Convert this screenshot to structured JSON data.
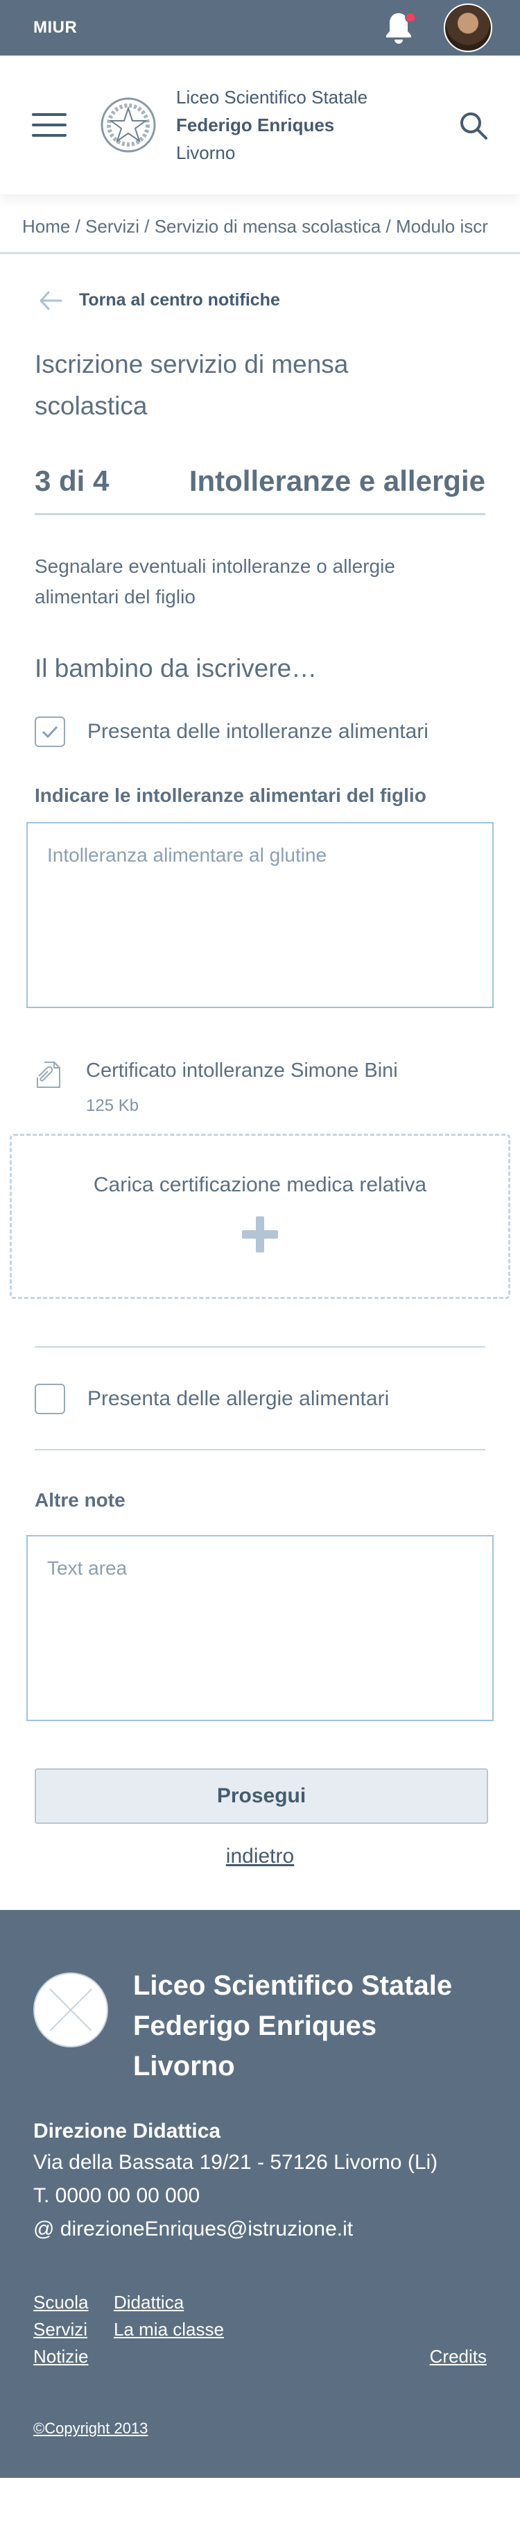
{
  "topbar": {
    "brand": "MIUR",
    "notification_icon": "bell-icon",
    "notification_color": "#f73e5a"
  },
  "header": {
    "school_line1": "Liceo Scientifico Statale",
    "school_line2": "Federigo Enriques",
    "school_line3": "Livorno"
  },
  "breadcrumb": "Home / Servizi / Servizio di mensa scolastica / Modulo iscr",
  "back_label": "Torna al centro notifiche",
  "page_title": "Iscrizione servizio di mensa scolastica",
  "step": {
    "number": "3 di 4",
    "name": "Intolleranze e allergie"
  },
  "description": "Segnalare eventuali intolleranze o allergie alimentari del figlio",
  "subtitle": "Il bambino da iscrivere…",
  "intolerance_checkbox": {
    "label": "Presenta delle intolleranze alimentari",
    "checked": true
  },
  "intolerance_field": {
    "label": "Indicare le intolleranze alimentari del figlio",
    "value": "Intolleranza alimentare al glutine"
  },
  "file": {
    "name": "Certificato intolleranze Simone Bini",
    "size": "125 Kb"
  },
  "upload_label": "Carica certificazione medica relativa",
  "allergy_checkbox": {
    "label": "Presenta delle allergie alimentari",
    "checked": false
  },
  "notes": {
    "label": "Altre note",
    "placeholder": "Text area"
  },
  "continue_button": "Prosegui",
  "back_link": "indietro",
  "footer": {
    "school_line1": "Liceo Scientifico Statale",
    "school_line2": "Federigo Enriques",
    "school_line3": "Livorno",
    "section_title": "Direzione Didattica",
    "address": "Via della Bassata 19/21 - 57126 Livorno (Li)",
    "phone": "T. 0000 00 00 000",
    "email": "@ direzioneEnriques@istruzione.it",
    "links": [
      "Scuola",
      "Didattica",
      "Servizi",
      "La mia classe",
      "Notizie"
    ],
    "credits": "Credits",
    "copyright": "©Copyright 2013"
  },
  "colors": {
    "primary": "#5c6f82",
    "text": "#455b71",
    "accent_line": "#c7d7e3"
  }
}
